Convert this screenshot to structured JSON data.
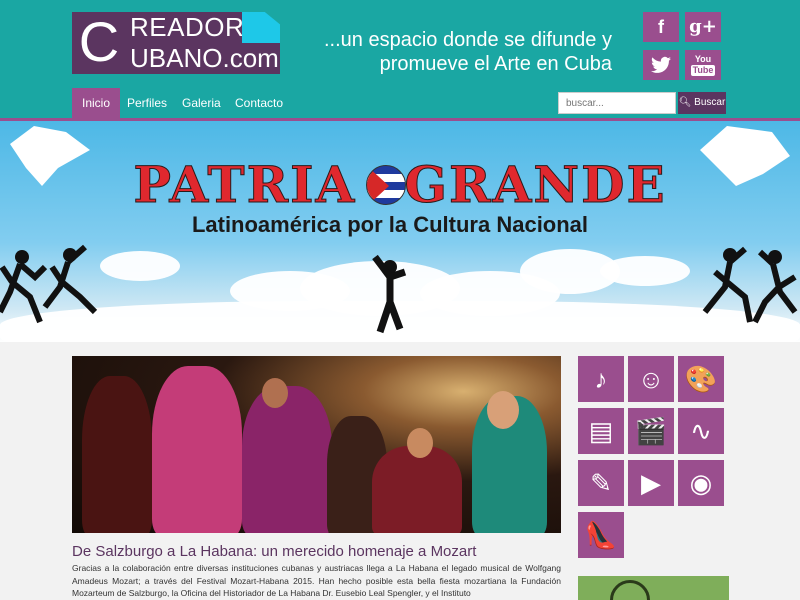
{
  "logo": {
    "letter_c": "C",
    "line1": "READOR",
    "line2": "UBANO",
    "tld": ".com"
  },
  "tagline": {
    "line1": "...un espacio donde se difunde y",
    "line2": "promueve el Arte en Cuba"
  },
  "social": {
    "facebook": "f",
    "googleplus": "g+",
    "twitter": "🐦",
    "youtube_top": "You",
    "youtube_bottom": "Tube"
  },
  "nav": {
    "items": [
      {
        "label": "Inicio",
        "active": true
      },
      {
        "label": "Perfiles",
        "active": false
      },
      {
        "label": "Galeria",
        "active": false
      },
      {
        "label": "Contacto",
        "active": false
      }
    ]
  },
  "search": {
    "placeholder": "buscar...",
    "button_label": "Buscar"
  },
  "banner": {
    "title_left": "PATRIA",
    "title_right": "GRANDE",
    "subtitle": "Latinoamérica por la Cultura Nacional"
  },
  "article": {
    "title": "De Salzburgo a La Habana: un merecido homenaje a Mozart",
    "body": "Gracias a la colaboración entre diversas instituciones cubanas y austriacas llega a La Habana el legado musical de Wolfgang Amadeus Mozart; a través del Festival Mozart-Habana 2015. Han hecho posible esta bella fiesta mozartiana la Fundación Mozarteum de Salzburgo, la Oficina del Historiador de La Habana Dr. Eusebio Leal Spengler, y el Instituto"
  },
  "sidebar": {
    "tiles": [
      {
        "icon": "music-note-icon",
        "glyph": "♪"
      },
      {
        "icon": "theater-masks-icon",
        "glyph": "☺"
      },
      {
        "icon": "palette-icon",
        "glyph": "🎨"
      },
      {
        "icon": "books-icon",
        "glyph": "▤"
      },
      {
        "icon": "film-clapper-icon",
        "glyph": "🎬"
      },
      {
        "icon": "dance-icon",
        "glyph": "∿"
      },
      {
        "icon": "pen-icon",
        "glyph": "✎"
      },
      {
        "icon": "presentation-icon",
        "glyph": "▶"
      },
      {
        "icon": "camera-icon",
        "glyph": "◉"
      },
      {
        "icon": "high-heel-icon",
        "glyph": "👠"
      }
    ]
  },
  "colors": {
    "header_bg": "#1aa7a3",
    "accent": "#9a4e8e",
    "logo_bg": "#5b3560"
  }
}
